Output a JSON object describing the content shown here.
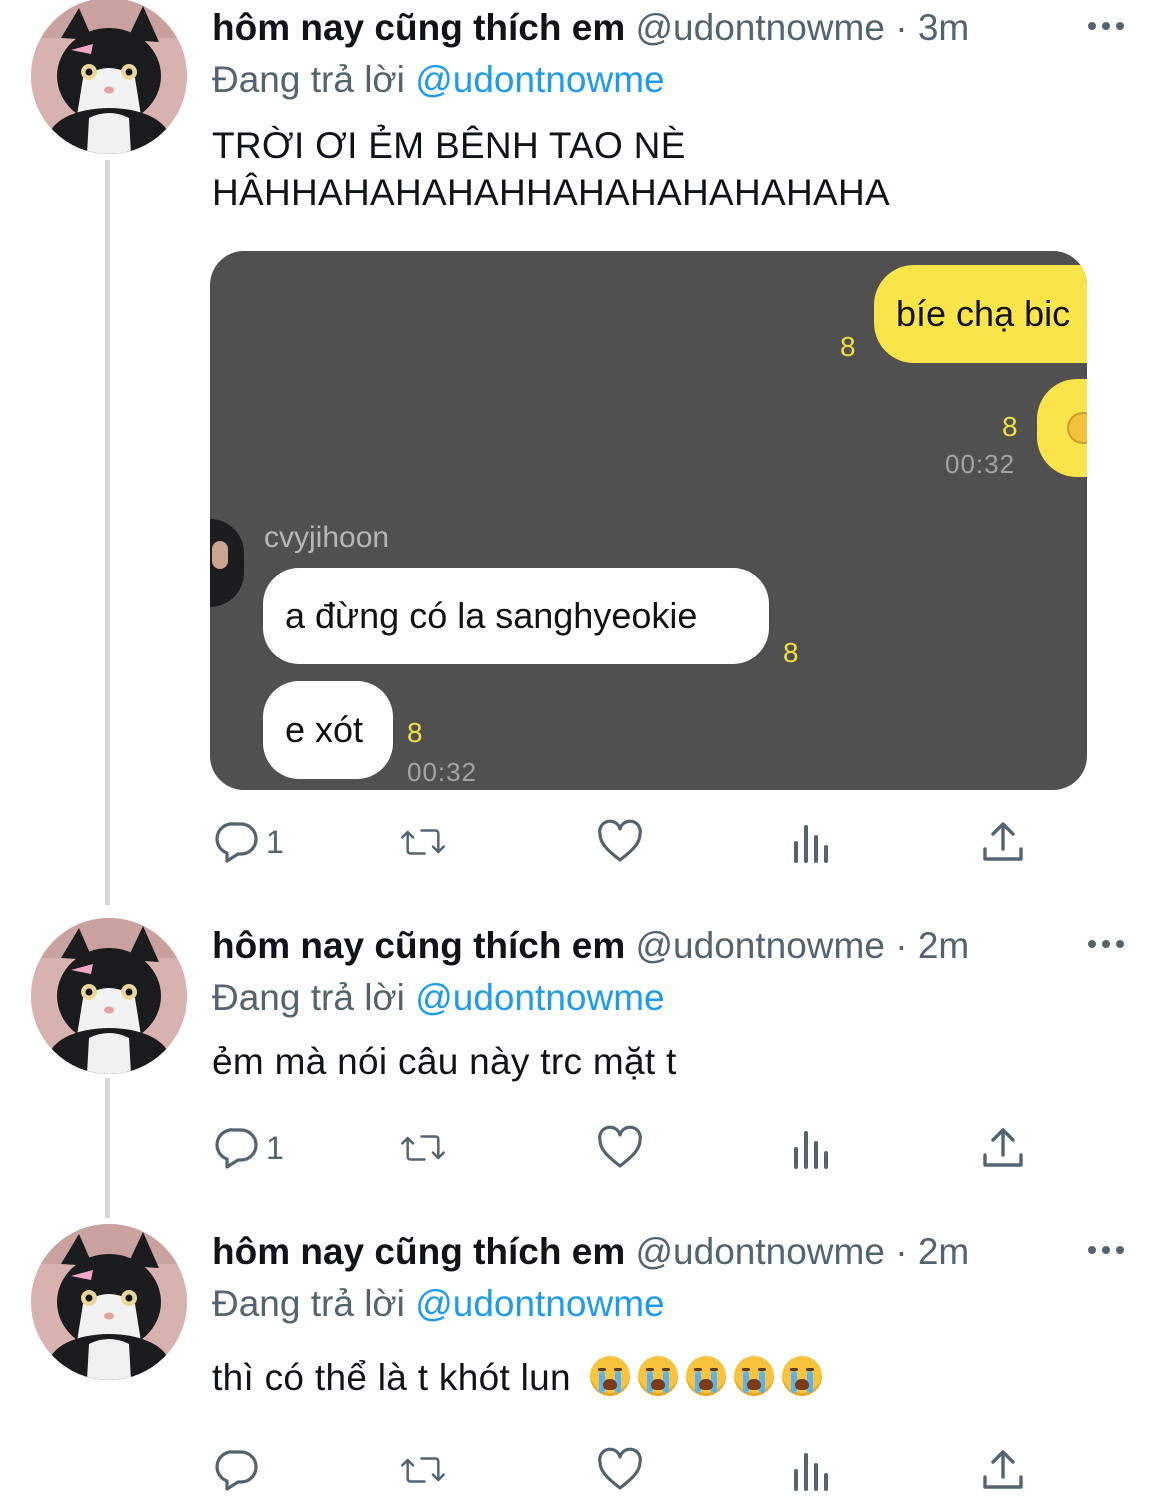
{
  "tweets": [
    {
      "name": "hôm nay cũng thích em",
      "handle": "@udontnowme",
      "separator": "·",
      "time": "3m",
      "reply_prefix": "Đang trả lời",
      "reply_mention": "@udontnowme",
      "text_lines": [
        "TRỜI ƠI ẺM BÊNH TAO NÈ",
        "HÂHHAHAHAHAHHAHAHAHAHAHAHA"
      ],
      "reply_count": "1"
    },
    {
      "name": "hôm nay cũng thích em",
      "handle": "@udontnowme",
      "separator": "·",
      "time": "2m",
      "reply_prefix": "Đang trả lời",
      "reply_mention": "@udontnowme",
      "text": "ẻm mà nói câu này trc mặt t",
      "reply_count": "1"
    },
    {
      "name": "hôm nay cũng thích em",
      "handle": "@udontnowme",
      "separator": "·",
      "time": "2m",
      "reply_prefix": "Đang trả lời",
      "reply_mention": "@udontnowme",
      "text": "thì có thể là t khót lun",
      "emoji_count": 5,
      "emoji_icon": "loudly-crying-face-emoji",
      "reply_count": ""
    }
  ],
  "chat_screenshot": {
    "sent": [
      {
        "text": "bíe chạ bic",
        "read": "8"
      },
      {
        "text": "🥺",
        "read": "8",
        "time": "00:32"
      }
    ],
    "sender_name": "cvyjihoon",
    "received": [
      {
        "text": "a đừng có la sanghyeokie",
        "read": "8"
      },
      {
        "text": "e xót",
        "read": "8",
        "time": "00:32"
      }
    ]
  },
  "icons": {
    "reply": "speech-bubble-icon",
    "retweet": "retweet-arrows-icon",
    "like": "heart-icon",
    "views": "bar-chart-icon",
    "share": "share-upload-icon",
    "more": "more-dots-icon"
  },
  "colors": {
    "link": "#1d9bf0",
    "meta": "#536471",
    "chat_bg": "#505050",
    "chat_yellow": "#f9e54a"
  }
}
